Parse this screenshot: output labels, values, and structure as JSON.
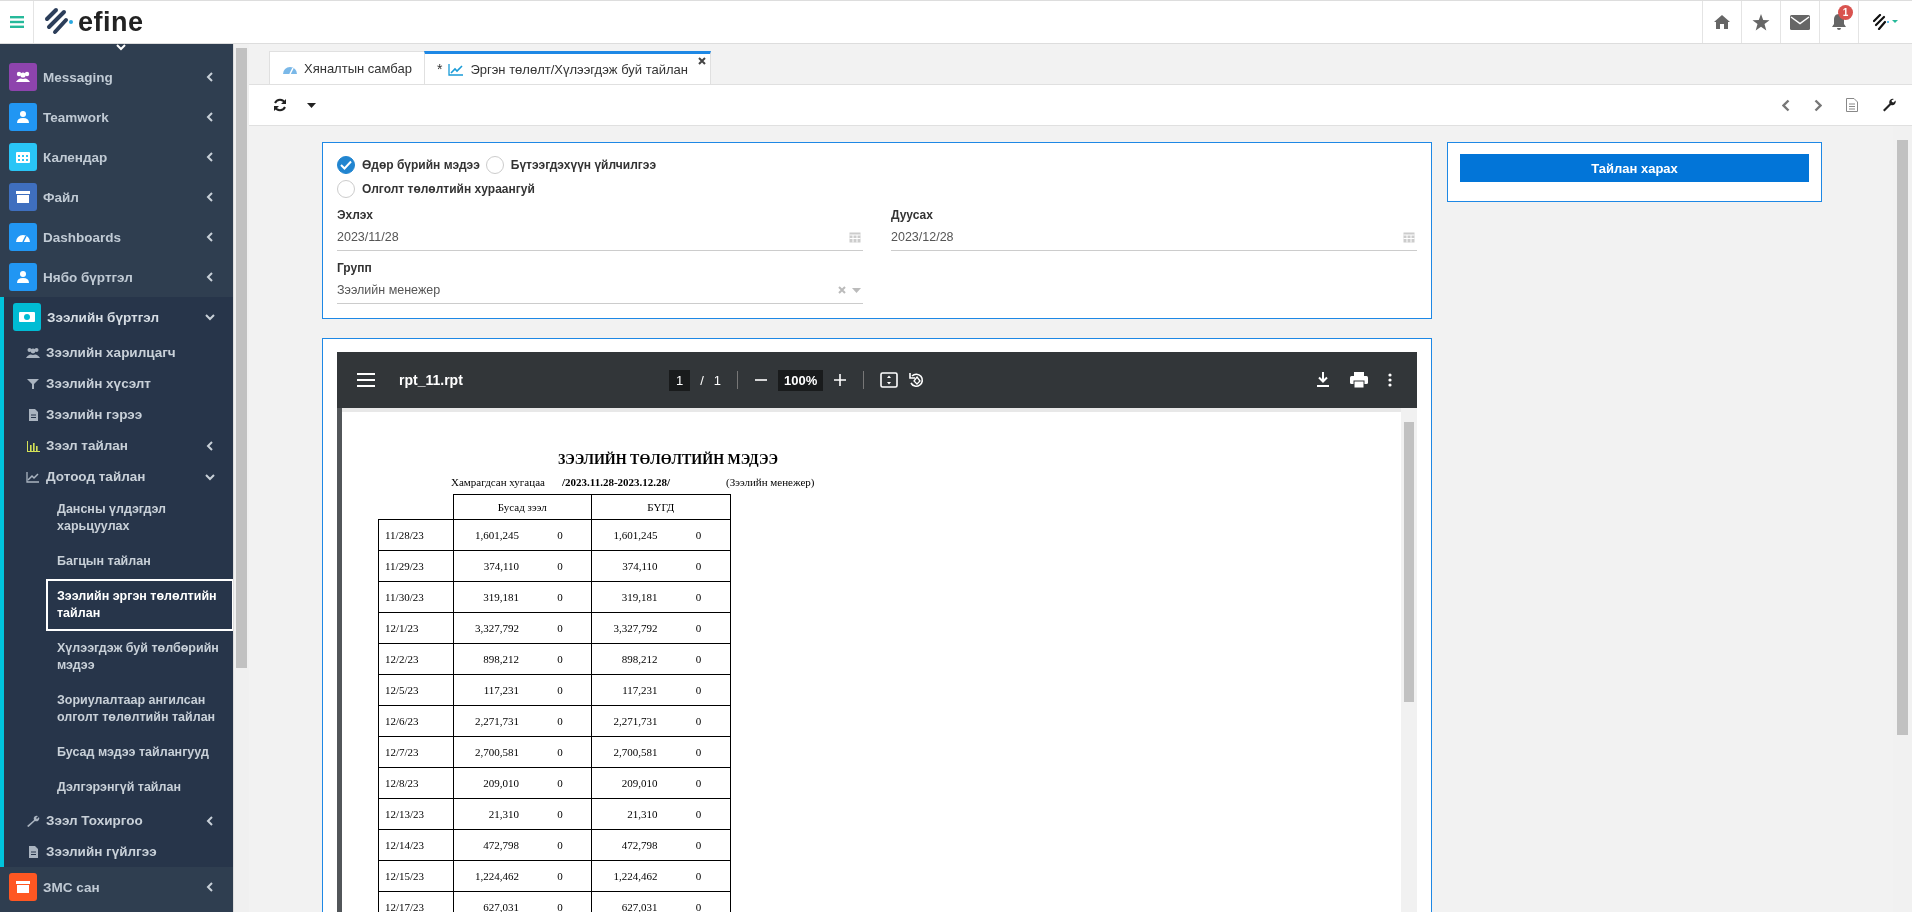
{
  "header": {
    "logo": "efine",
    "notifications": "1"
  },
  "sidebar": {
    "items": [
      {
        "label": "Messaging",
        "color": "#8e44ad",
        "kind": "group",
        "expanded": false
      },
      {
        "label": "Teamwork",
        "color": "#2196f3",
        "kind": "group",
        "expanded": false
      },
      {
        "label": "Календар",
        "color": "#29c5f6",
        "kind": "group",
        "expanded": false
      },
      {
        "label": "Файл",
        "color": "#3f6fbf",
        "kind": "group",
        "expanded": false
      },
      {
        "label": "Dashboards",
        "color": "#2196f3",
        "kind": "group",
        "expanded": false
      },
      {
        "label": "Нябо бүртгэл",
        "color": "#2196f3",
        "kind": "group",
        "expanded": false
      },
      {
        "label": "Зээлийн бүртгэл",
        "color": "#00bcd4",
        "kind": "group",
        "expanded": true,
        "children": [
          {
            "label": "Зээлийн харилцагч",
            "kind": "link"
          },
          {
            "label": "Зээлийн хүсэлт",
            "kind": "link"
          },
          {
            "label": "Зээлийн гэрээ",
            "kind": "link"
          },
          {
            "label": "Зээл тайлан",
            "kind": "group",
            "expanded": false
          },
          {
            "label": "Дотоод тайлан",
            "kind": "group",
            "expanded": true,
            "children": [
              {
                "label": "Дансны үлдэгдэл харьцуулах",
                "selected": false
              },
              {
                "label": "Багцын тайлан",
                "selected": false
              },
              {
                "label": "Зээлийн эргэн төлөлтийн тайлан",
                "selected": true
              },
              {
                "label": "Хүлээгдэж буй төлбөрийн мэдээ",
                "selected": false
              },
              {
                "label": "Зориулалтаар ангилсан олголт төлөлтийн тайлан",
                "selected": false
              },
              {
                "label": "Бусад мэдээ тайлангууд",
                "selected": false
              },
              {
                "label": "Дэлгэрэнгүй тайлан",
                "selected": false
              }
            ]
          },
          {
            "label": "Зээл Тохиргоо",
            "kind": "group",
            "expanded": false
          },
          {
            "label": "Зээлийн гүйлгээ",
            "kind": "link"
          }
        ]
      },
      {
        "label": "ЗМС сан",
        "color": "#ff5722",
        "kind": "group",
        "expanded": false
      }
    ]
  },
  "tabs": [
    {
      "label": "Хяналтын самбар",
      "selected": false
    },
    {
      "label": "Эргэн төлөлт/Хүлээгдэж буй тайлан",
      "selected": true,
      "modified_mark": "*"
    }
  ],
  "form": {
    "options": [
      {
        "label": "Өдөр бүрийн мэдээ",
        "selected": true
      },
      {
        "label": "Бүтээгдэхүүн үйлчилгээ",
        "selected": false
      },
      {
        "label": "Олголт төлөлтийн хураангуй",
        "selected": false
      }
    ],
    "start": {
      "label": "Эхлэх",
      "value": "2023/11/28"
    },
    "end": {
      "label": "Дуусах",
      "value": "2023/12/28"
    },
    "group": {
      "label": "Групп",
      "value": "Зээлийн менежер"
    }
  },
  "view_button": "Тайлан харах",
  "pdf": {
    "file_name": "rpt_11.rpt",
    "page": "1",
    "page_separator": "/",
    "page_count": "1",
    "zoom": "100%",
    "report": {
      "title": "ЗЭЭЛИЙН ТӨЛӨЛТИЙН МЭДЭЭ",
      "period_label": "Хамрагдсан хугацаа",
      "period": "/2023.11.28-2023.12.28/",
      "group": "(Зээлийн менежер)",
      "columns": [
        "Бусад зээл",
        "БҮГД"
      ],
      "rows": [
        {
          "date": "11/28/23",
          "values": [
            "1,601,245",
            "0",
            "1,601,245",
            "0"
          ]
        },
        {
          "date": "11/29/23",
          "values": [
            "374,110",
            "0",
            "374,110",
            "0"
          ]
        },
        {
          "date": "11/30/23",
          "values": [
            "319,181",
            "0",
            "319,181",
            "0"
          ]
        },
        {
          "date": "12/1/23",
          "values": [
            "3,327,792",
            "0",
            "3,327,792",
            "0"
          ]
        },
        {
          "date": "12/2/23",
          "values": [
            "898,212",
            "0",
            "898,212",
            "0"
          ]
        },
        {
          "date": "12/5/23",
          "values": [
            "117,231",
            "0",
            "117,231",
            "0"
          ]
        },
        {
          "date": "12/6/23",
          "values": [
            "2,271,731",
            "0",
            "2,271,731",
            "0"
          ]
        },
        {
          "date": "12/7/23",
          "values": [
            "2,700,581",
            "0",
            "2,700,581",
            "0"
          ]
        },
        {
          "date": "12/8/23",
          "values": [
            "209,010",
            "0",
            "209,010",
            "0"
          ]
        },
        {
          "date": "12/13/23",
          "values": [
            "21,310",
            "0",
            "21,310",
            "0"
          ]
        },
        {
          "date": "12/14/23",
          "values": [
            "472,798",
            "0",
            "472,798",
            "0"
          ]
        },
        {
          "date": "12/15/23",
          "values": [
            "1,224,462",
            "0",
            "1,224,462",
            "0"
          ]
        },
        {
          "date": "12/17/23",
          "values": [
            "627,031",
            "0",
            "627,031",
            "0"
          ]
        }
      ]
    }
  }
}
